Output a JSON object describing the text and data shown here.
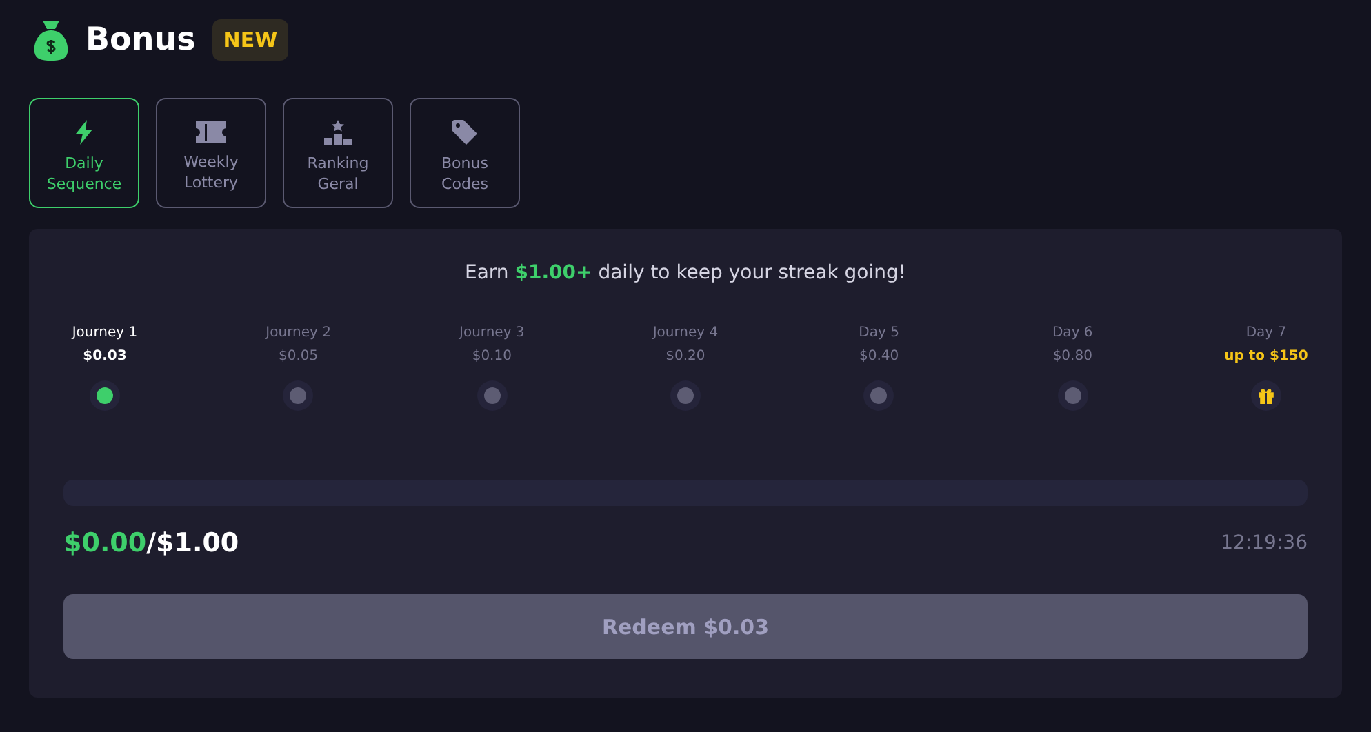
{
  "header": {
    "title": "Bonus",
    "badge": "NEW"
  },
  "tabs": [
    {
      "label": "Daily Sequence",
      "selected": true
    },
    {
      "label": "Weekly Lottery",
      "selected": false
    },
    {
      "label": "Ranking Geral",
      "selected": false
    },
    {
      "label": "Bonus Codes",
      "selected": false
    }
  ],
  "streak": {
    "headline": "Earn **$1.00+** daily to keep your streak going!",
    "steps": [
      {
        "label": "Journey 1",
        "amount": "$0.03",
        "kind": "done"
      },
      {
        "label": "Journey 2",
        "amount": "$0.05",
        "kind": "pending"
      },
      {
        "label": "Journey 3",
        "amount": "$0.10",
        "kind": "pending"
      },
      {
        "label": "Journey 4",
        "amount": "$0.20",
        "kind": "pending"
      },
      {
        "label": "Day 5",
        "amount": "$0.40",
        "kind": "pending"
      },
      {
        "label": "Day 6",
        "amount": "$0.80",
        "kind": "pending"
      },
      {
        "label": "Day 7",
        "amount": "up to $150",
        "kind": "gift"
      }
    ],
    "progress": {
      "level": 0,
      "earned": "$0.00",
      "goal": "/$1.00",
      "timer": "12:19:36"
    },
    "redeem_button": {
      "label": "Redeem $0.03",
      "disabled": true
    }
  }
}
